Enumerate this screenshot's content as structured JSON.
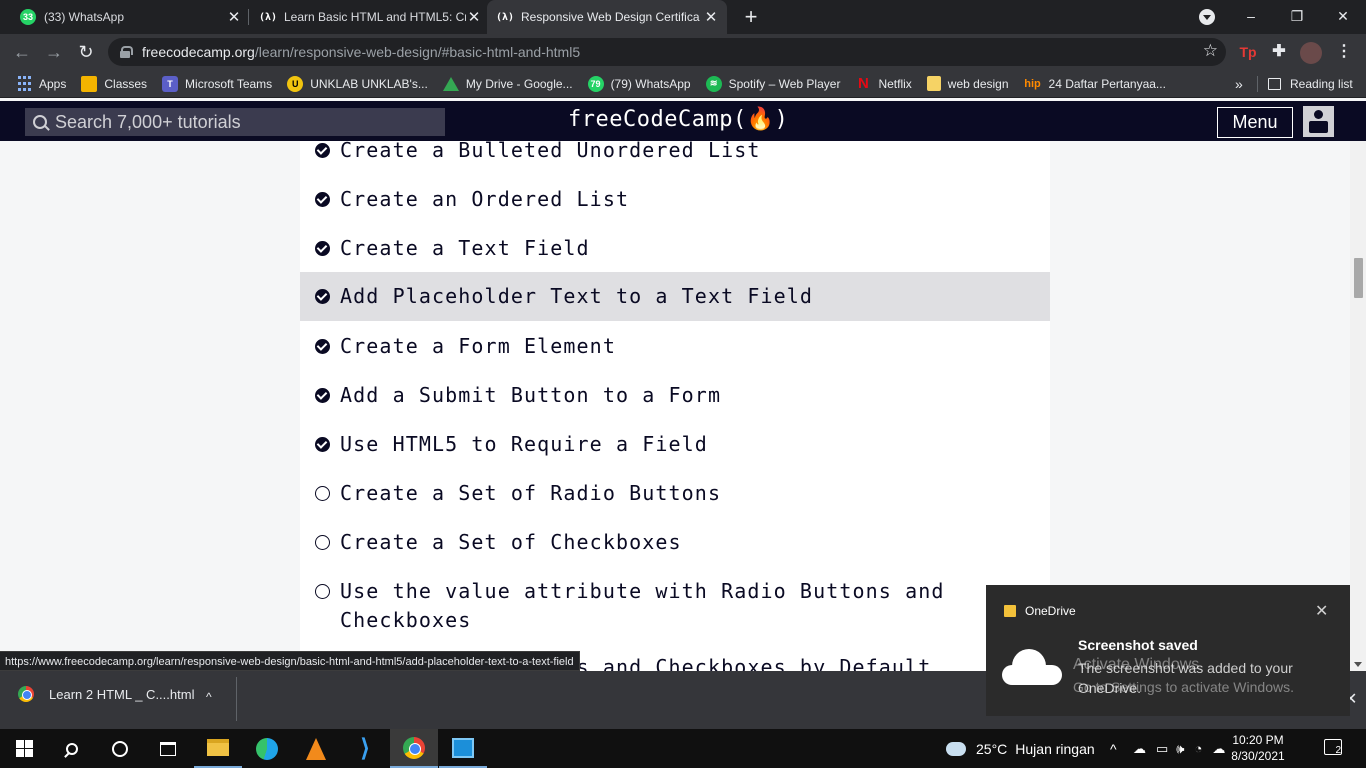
{
  "browser": {
    "tabs": [
      {
        "title": "(33) WhatsApp",
        "favicon": "whatsapp-icon",
        "badge": "33",
        "active": false
      },
      {
        "title": "Learn Basic HTML and HTML5: Cr",
        "favicon": "freecodecamp-icon",
        "active": false
      },
      {
        "title": "Responsive Web Design Certifica",
        "favicon": "freecodecamp-icon",
        "active": true
      }
    ],
    "favicon_glyph": "(λ)",
    "new_tab_glyph": "+",
    "window_controls": {
      "minimize": "–",
      "restore": "❐",
      "close": "✕"
    },
    "url_host": "freecodecamp.org",
    "url_path": "/learn/responsive-web-design/#basic-html-and-html5",
    "extensions": {
      "tp_label": "Tp"
    },
    "bookmarks": [
      {
        "label": "Apps",
        "icon": "apps-grid-icon"
      },
      {
        "label": "Classes",
        "icon": "classroom-icon"
      },
      {
        "label": "Microsoft Teams",
        "icon": "teams-icon",
        "glyph": "T"
      },
      {
        "label": "UNKLAB UNKLAB's...",
        "icon": "unklab-icon",
        "glyph": "U"
      },
      {
        "label": "My Drive - Google...",
        "icon": "google-drive-icon"
      },
      {
        "label": "(79) WhatsApp",
        "icon": "whatsapp-icon",
        "glyph": "79"
      },
      {
        "label": "Spotify – Web Player",
        "icon": "spotify-icon",
        "glyph": "≋"
      },
      {
        "label": "Netflix",
        "icon": "netflix-icon",
        "glyph": "N"
      },
      {
        "label": "web design",
        "icon": "folder-icon"
      },
      {
        "label": "24 Daftar Pertanyaa...",
        "icon": "hip-icon",
        "glyph": "hip"
      }
    ],
    "more_bookmarks": "»",
    "reading_list": "Reading list",
    "status_url": "https://www.freecodecamp.org/learn/responsive-web-design/basic-html-and-html5/add-placeholder-text-to-a-text-field"
  },
  "fcc": {
    "search_placeholder": "Search 7,000+ tutorials",
    "logo_text": "freeCodeCamp(🔥)",
    "menu_label": "Menu"
  },
  "lessons": [
    {
      "title": "Create a Bulleted Unordered List",
      "completed": true,
      "highlighted": false
    },
    {
      "title": "Create an Ordered List",
      "completed": true,
      "highlighted": false
    },
    {
      "title": "Create a Text Field",
      "completed": true,
      "highlighted": false
    },
    {
      "title": "Add Placeholder Text to a Text Field",
      "completed": true,
      "highlighted": true
    },
    {
      "title": "Create a Form Element",
      "completed": true,
      "highlighted": false
    },
    {
      "title": "Add a Submit Button to a Form",
      "completed": true,
      "highlighted": false
    },
    {
      "title": "Use HTML5 to Require a Field",
      "completed": true,
      "highlighted": false
    },
    {
      "title": "Create a Set of Radio Buttons",
      "completed": false,
      "highlighted": false
    },
    {
      "title": "Create a Set of Checkboxes",
      "completed": false,
      "highlighted": false
    },
    {
      "title": "Use the value attribute with Radio Buttons and Checkboxes",
      "completed": false,
      "highlighted": false
    },
    {
      "title": "Check Radio Buttons and Checkboxes by Default",
      "completed": false,
      "highlighted": false
    }
  ],
  "downloads": {
    "item_label": "Learn 2 HTML _ C....html",
    "chevron": "^",
    "close": "✕"
  },
  "toast": {
    "app_name": "OneDrive",
    "title": "Screenshot saved",
    "body": "The screenshot was added to your OneDrive.",
    "close": "✕"
  },
  "watermark": {
    "line1": "Activate Windows",
    "line2": "Go to Settings to activate Windows."
  },
  "taskbar": {
    "weather_temp": "25°C",
    "weather_desc": "Hujan ringan",
    "tray_chevron": "^",
    "time": "10:20 PM",
    "date": "8/30/2021",
    "notification_count": "2",
    "vscode_glyph": "⟩"
  },
  "colors": {
    "fcc_nav": "#0a0a23",
    "highlight_row": "#dfdfe2",
    "chrome_dark": "#202124",
    "chrome_toolbar": "#35363a"
  }
}
